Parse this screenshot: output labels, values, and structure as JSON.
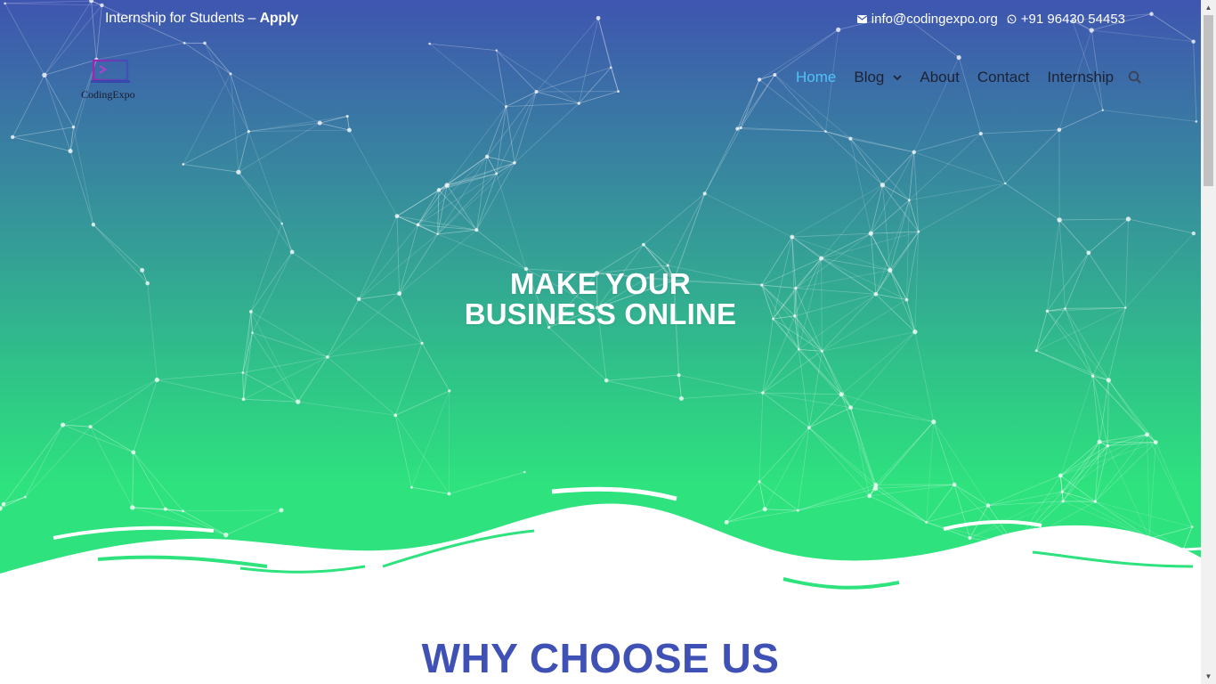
{
  "topbar": {
    "promo_text": "Internship for Students – ",
    "promo_link": "Apply",
    "email": "info@codingexpo.org",
    "phone": "+91 96430 54453",
    "email_icon": "envelope-icon",
    "phone_icon": "whatsapp-icon"
  },
  "brand": {
    "logo_text": "CodingExpo",
    "logo_icon": "laptop-icon"
  },
  "nav": {
    "items": [
      {
        "label": "Home",
        "active": true
      },
      {
        "label": "Blog",
        "has_dropdown": true
      },
      {
        "label": "About"
      },
      {
        "label": "Contact"
      },
      {
        "label": "Internship"
      }
    ],
    "search_icon": "search-icon",
    "active_color": "#4fc3f7"
  },
  "hero": {
    "title_line1": "MAKE YOUR",
    "title_line2": "BUSINESS ONLINE",
    "gradient_top": "#3f55b0",
    "gradient_bottom": "#2ee27e"
  },
  "section": {
    "title": "WHY CHOOSE US",
    "color": "#3f51b5"
  }
}
